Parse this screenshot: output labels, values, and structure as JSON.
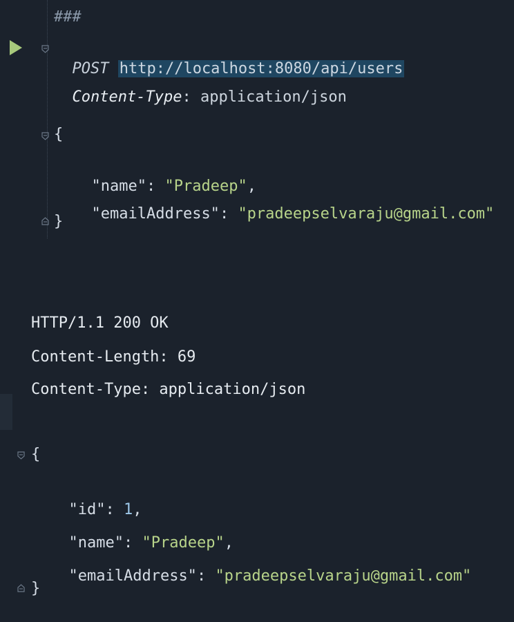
{
  "request": {
    "separator": "###",
    "method": "POST",
    "url": "http://localhost:8080/api/users",
    "header_key": "Content-Type",
    "header_colon": ":",
    "header_value": "application/json",
    "body_open": "{",
    "body_close": "}",
    "fields": [
      {
        "key": "\"name\"",
        "value": "\"Pradeep\"",
        "trail": ","
      },
      {
        "key": "\"emailAddress\"",
        "value": "\"pradeepselvaraju@gmail.com\"",
        "trail": ""
      }
    ]
  },
  "response": {
    "status_line": "HTTP/1.1 200 OK",
    "headers": [
      "Content-Length: 69",
      "Content-Type: application/json"
    ],
    "body_open": "{",
    "body_close": "}",
    "fields": [
      {
        "key": "\"id\"",
        "value": "1",
        "trail": ","
      },
      {
        "key": "\"name\"",
        "value": "\"Pradeep\"",
        "trail": ","
      },
      {
        "key": "\"emailAddress\"",
        "value": "\"pradeepselvaraju@gmail.com\"",
        "trail": ""
      }
    ]
  },
  "icons": {
    "run": "run-request-icon",
    "fold": "fold-marker-icon"
  },
  "colors": {
    "background": "#1b222c",
    "url_highlight": "#1f4661",
    "string": "#b8d48a",
    "number": "#9dc7e8",
    "run_icon": "#a7c97c"
  }
}
